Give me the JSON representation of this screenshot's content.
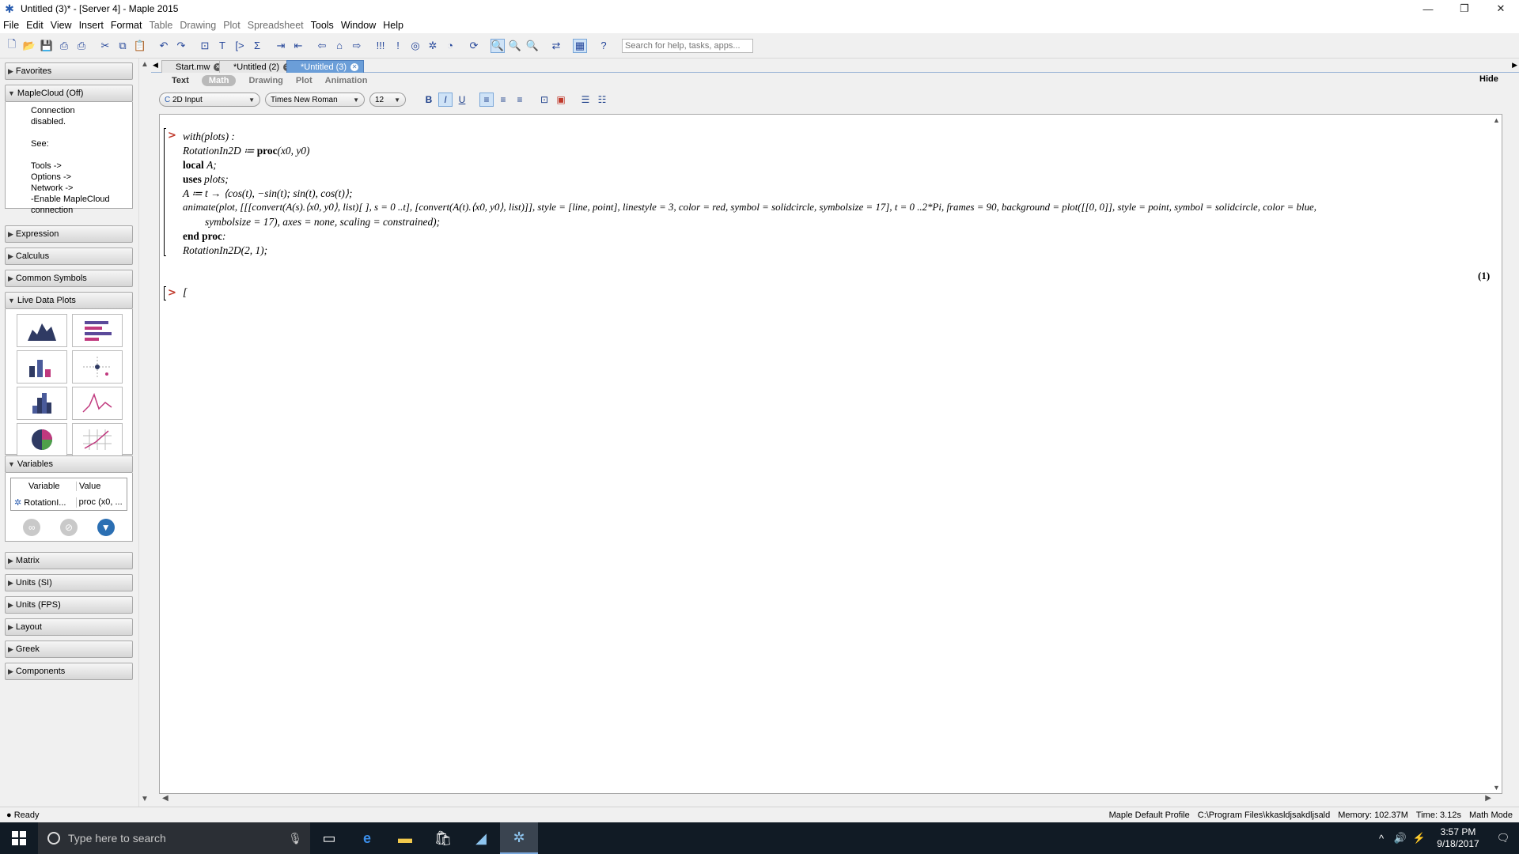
{
  "window": {
    "title": "Untitled (3)* - [Server 4] - Maple 2015"
  },
  "menu": [
    "File",
    "Edit",
    "View",
    "Insert",
    "Format",
    "Table",
    "Drawing",
    "Plot",
    "Spreadsheet",
    "Tools",
    "Window",
    "Help"
  ],
  "menu_disabled": [
    "Table",
    "Drawing",
    "Plot",
    "Spreadsheet"
  ],
  "toolbar": {
    "search_placeholder": "Search for help, tasks, apps..."
  },
  "palettes": {
    "favorites": "Favorites",
    "maplecloud": "MapleCloud (Off)",
    "cloud_lines": [
      "Connection",
      "disabled.",
      "",
      "See:",
      "",
      "Tools ->",
      "Options ->",
      "Network ->",
      "-Enable MapleCloud",
      "connection"
    ],
    "expression": "Expression",
    "calculus": "Calculus",
    "common_symbols": "Common Symbols",
    "live_data_plots": "Live Data Plots",
    "variables": "Variables",
    "var_header_variable": "Variable",
    "var_header_value": "Value",
    "var_row_name": "RotationI...",
    "var_row_value": "proc (x0, ...",
    "matrix": "Matrix",
    "units_si": "Units (SI)",
    "units_fps": "Units (FPS)",
    "layout": "Layout",
    "greek": "Greek",
    "components": "Components"
  },
  "tabs": [
    {
      "label": "Start.mw",
      "active": false
    },
    {
      "label": "*Untitled (2)",
      "active": false
    },
    {
      "label": "*Untitled (3)",
      "active": true
    }
  ],
  "modes": [
    "Text",
    "Math",
    "Drawing",
    "Plot",
    "Animation"
  ],
  "active_mode": "Math",
  "hide_label": "Hide",
  "format": {
    "input_mode": "2D Input",
    "font": "Times New Roman",
    "size": "12"
  },
  "code": {
    "line1": "with(plots) :",
    "line2a": "RotationIn2D ≔ ",
    "line2b": "proc",
    "line2c": "(x0, y0)",
    "line3a": "local ",
    "line3b": "A;",
    "line4a": "uses ",
    "line4b": "plots;",
    "line5": "A ≔ t → ⟨cos(t), −sin(t); sin(t), cos(t)⟩;",
    "line6": "animate(plot, [[[convert(A(s).⟨x0, y0⟩, list)[ ], s = 0 ..t], [convert(A(t).⟨x0, y0⟩, list)]], style = [line, point], linestyle = 3, color = red, symbol = solidcircle, symbolsize = 17], t = 0 ..2*Pi, frames = 90, background = plot([[0, 0]], style = point, symbol = solidcircle, color = blue,",
    "line7": "symbolsize = 17), axes = none, scaling = constrained);",
    "line8a": "end proc",
    "line8b": ":",
    "line9": "RotationIn2D(2, 1);",
    "eq_number": "(1)"
  },
  "status": {
    "left": "Ready",
    "profile": "Maple Default Profile",
    "path": "C:\\Program Files\\kkasldjsakdljsald",
    "memory": "Memory: 102.37M",
    "time": "Time: 3.12s",
    "mode": "Math Mode"
  },
  "taskbar": {
    "search_placeholder": "Type here to search",
    "time": "3:57 PM",
    "date": "9/18/2017"
  },
  "colors": {
    "accent": "#6b9ed8",
    "prompt": "#c0392b",
    "taskbar": "#111b25"
  }
}
